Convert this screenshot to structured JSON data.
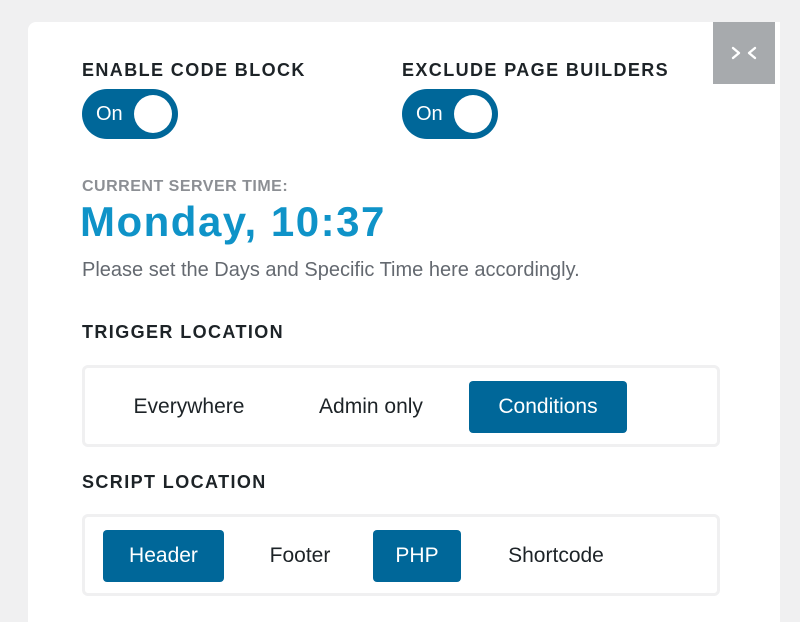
{
  "toggles": {
    "enable_code_block": {
      "label": "ENABLE CODE BLOCK",
      "state": "On"
    },
    "exclude_page_builders": {
      "label": "EXCLUDE PAGE BUILDERS",
      "state": "On"
    }
  },
  "server_time": {
    "label": "CURRENT SERVER TIME:",
    "value": "Monday, 10:37",
    "note": "Please set the Days and Specific Time here accordingly."
  },
  "trigger_location": {
    "label": "TRIGGER LOCATION",
    "options": [
      "Everywhere",
      "Admin only",
      "Conditions"
    ],
    "selected": "Conditions"
  },
  "script_location": {
    "label": "SCRIPT LOCATION",
    "options": [
      "Header",
      "Footer",
      "PHP",
      "Shortcode"
    ],
    "selected": [
      "Header",
      "PHP"
    ]
  },
  "icons": {
    "collapse": "collapse-arrows-icon"
  },
  "colors": {
    "accent": "#006799",
    "time": "#0f93c8",
    "background": "#f0f0f1",
    "collapse_button": "#a7aaad"
  }
}
